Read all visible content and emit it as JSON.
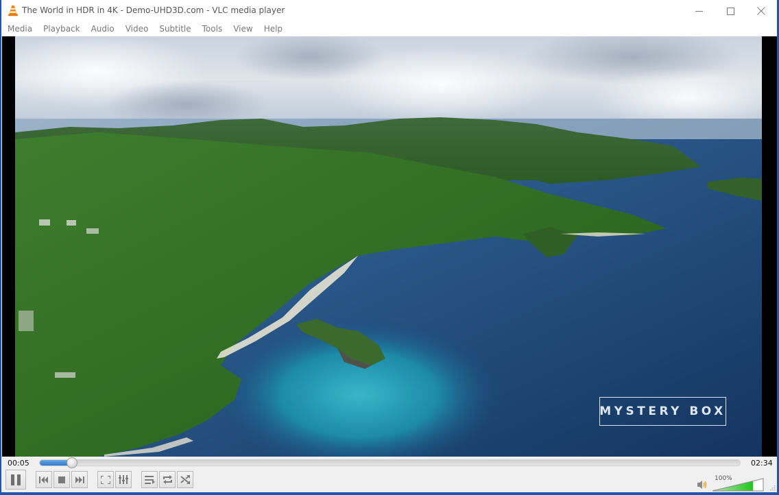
{
  "window": {
    "title": "The World in HDR in 4K - Demo-UHD3D.com - VLC media player",
    "app_icon": "vlc-cone-icon",
    "buttons": {
      "minimize": "minimize-icon",
      "maximize": "maximize-icon",
      "close": "close-icon"
    }
  },
  "menu": {
    "items": [
      {
        "label": "Media"
      },
      {
        "label": "Playback"
      },
      {
        "label": "Audio"
      },
      {
        "label": "Video"
      },
      {
        "label": "Subtitle"
      },
      {
        "label": "Tools"
      },
      {
        "label": "View"
      },
      {
        "label": "Help"
      }
    ]
  },
  "video": {
    "description": "Aerial view of tropical island coastline with turquoise bay and deep blue ocean",
    "overlay_text": "MYSTERY BOX"
  },
  "playback": {
    "elapsed": "00:05",
    "total": "02:34",
    "progress_fraction": 0.032
  },
  "controls": {
    "buttons": [
      {
        "name": "pause-button",
        "icon": "pause-icon"
      },
      {
        "name": "previous-button",
        "icon": "skip-previous-icon"
      },
      {
        "name": "stop-button",
        "icon": "stop-icon"
      },
      {
        "name": "next-button",
        "icon": "skip-next-icon"
      },
      {
        "name": "fullscreen-button",
        "icon": "fullscreen-icon"
      },
      {
        "name": "extended-settings-button",
        "icon": "equalizer-sliders-icon"
      },
      {
        "name": "playlist-button",
        "icon": "playlist-icon"
      },
      {
        "name": "loop-button",
        "icon": "loop-icon"
      },
      {
        "name": "random-button",
        "icon": "shuffle-icon"
      }
    ]
  },
  "volume": {
    "label": "100%",
    "level_percent": 100,
    "icon": "speaker-icon",
    "colors": {
      "fill": "#2fc22f"
    }
  },
  "colors": {
    "seek_fill": "#3a82d2",
    "window_border": "#1d57b0"
  }
}
